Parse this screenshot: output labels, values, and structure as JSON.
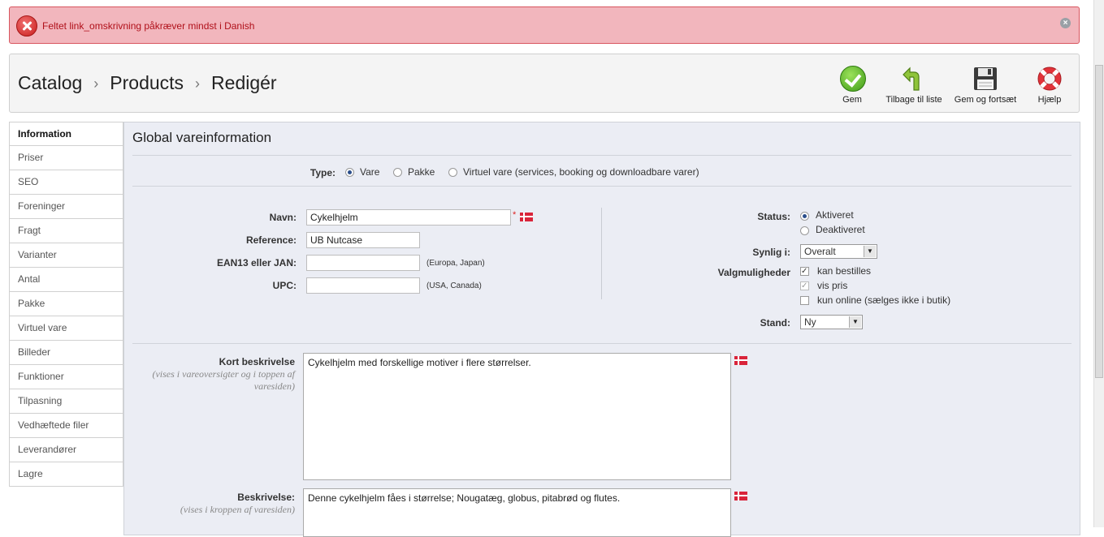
{
  "error": {
    "message": "Feltet link_omskrivning påkræver mindst i Danish",
    "close": "×"
  },
  "breadcrumb": {
    "items": [
      "Catalog",
      "Products",
      "Redigér"
    ],
    "separator": "›"
  },
  "toolbar": {
    "save": "Gem",
    "back": "Tilbage til liste",
    "save_continue": "Gem og fortsæt",
    "help": "Hjælp"
  },
  "sidebar": {
    "items": [
      "Information",
      "Priser",
      "SEO",
      "Foreninger",
      "Fragt",
      "Varianter",
      "Antal",
      "Pakke",
      "Virtuel vare",
      "Billeder",
      "Funktioner",
      "Tilpasning",
      "Vedhæftede filer",
      "Leverandører",
      "Lagre"
    ]
  },
  "form": {
    "title": "Global vareinformation",
    "type_label": "Type:",
    "type_options": [
      "Vare",
      "Pakke",
      "Virtuel vare (services, booking og downloadbare varer)"
    ],
    "name_label": "Navn:",
    "name_value": "Cykelhjelm",
    "required_mark": "*",
    "reference_label": "Reference:",
    "reference_value": "UB Nutcase",
    "ean_label": "EAN13 eller JAN:",
    "ean_value": "",
    "ean_hint": "(Europa, Japan)",
    "upc_label": "UPC:",
    "upc_value": "",
    "upc_hint": "(USA, Canada)",
    "status_label": "Status:",
    "status_options": [
      "Aktiveret",
      "Deaktiveret"
    ],
    "visible_label": "Synlig i:",
    "visible_value": "Overalt",
    "options_label": "Valgmuligheder",
    "options": [
      "kan bestilles",
      "vis pris",
      "kun online (sælges ikke i butik)"
    ],
    "condition_label": "Stand:",
    "condition_value": "Ny",
    "short_desc_label": "Kort beskrivelse",
    "short_desc_hint": "(vises i vareoversigter og i toppen af varesiden)",
    "short_desc_value": "Cykelhjelm med forskellige motiver i flere størrelser.",
    "desc_label": "Beskrivelse:",
    "desc_hint": "(vises i kroppen af varesiden)",
    "desc_value": "Denne cykelhjelm fåes i størrelse; Nougatæg, globus, pitabrød og flutes."
  },
  "colors": {
    "error_bg": "#f2b6bd",
    "error_text": "#b0101a",
    "panel_bg": "#ebedf4",
    "flag": "#d9243a"
  }
}
